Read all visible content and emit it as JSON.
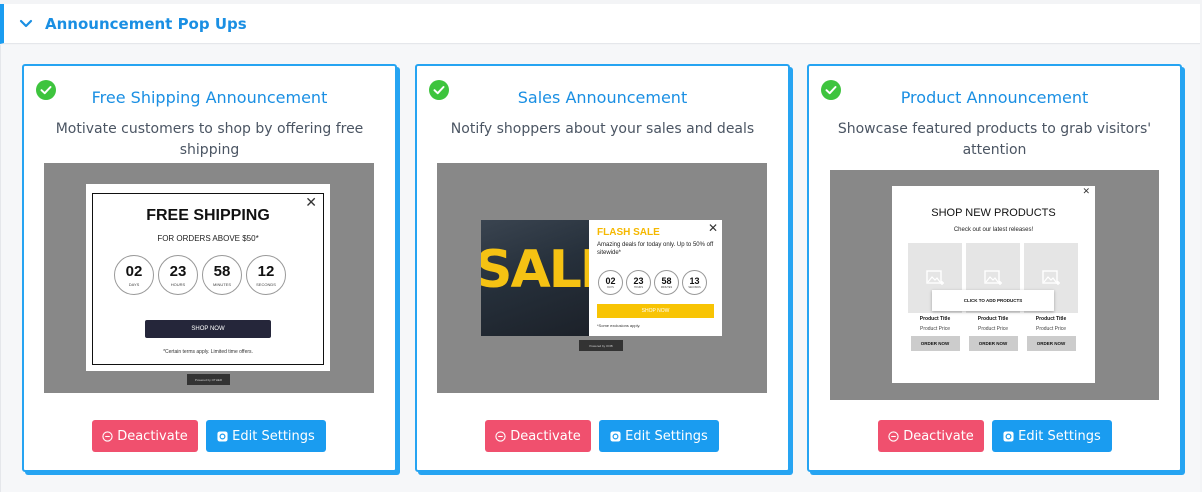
{
  "section": {
    "title": "Announcement Pop Ups"
  },
  "buttons": {
    "deactivate": "Deactivate",
    "edit": "Edit Settings"
  },
  "cards": [
    {
      "title": "Free Shipping Announcement",
      "description": "Motivate customers to shop by offering free shipping",
      "preview": {
        "heading": "FREE SHIPPING",
        "subheading": "FOR ORDERS ABOVE $50*",
        "countdown": [
          {
            "value": "02",
            "label": "DAYS"
          },
          {
            "value": "23",
            "label": "HOURS"
          },
          {
            "value": "58",
            "label": "MINUTES"
          },
          {
            "value": "12",
            "label": "SECONDS"
          }
        ],
        "cta": "SHOP NOW",
        "note": "*Certain terms apply. Limited time offers.",
        "powered": "Powered by OTHER"
      }
    },
    {
      "title": "Sales Announcement",
      "description": "Notify shoppers about your sales and deals",
      "preview": {
        "image_text": "SALE",
        "heading": "FLASH SALE",
        "text": "Amazing deals for today only. Up to 50% off sitewide*",
        "countdown": [
          {
            "value": "02",
            "label": "DAYS"
          },
          {
            "value": "23",
            "label": "HOURS"
          },
          {
            "value": "58",
            "label": "MINUTES"
          },
          {
            "value": "13",
            "label": "SECONDS"
          }
        ],
        "cta": "SHOP NOW",
        "note": "*Some exclusions apply.",
        "powered": "Powered by OOB"
      }
    },
    {
      "title": "Product Announcement",
      "description": "Showcase featured products to grab visitors' attention",
      "preview": {
        "heading": "SHOP NEW PRODUCTS",
        "subheading": "Check out our latest releases!",
        "click_label": "CLICK TO ADD PRODUCTS",
        "products": [
          {
            "title": "Product Title",
            "price": "Product Price",
            "cta": "ORDER NOW"
          },
          {
            "title": "Product Title",
            "price": "Product Price",
            "cta": "ORDER NOW"
          },
          {
            "title": "Product Title",
            "price": "Product Price",
            "cta": "ORDER NOW"
          }
        ]
      }
    }
  ],
  "colors": {
    "accent": "#1a9cf0",
    "deactivate": "#f0506e",
    "check": "#3ec43e"
  },
  "icons": [
    "chevron-down-icon",
    "check-circle-icon",
    "minus-circle-icon",
    "gear-icon",
    "close-icon",
    "image-placeholder-icon"
  ]
}
